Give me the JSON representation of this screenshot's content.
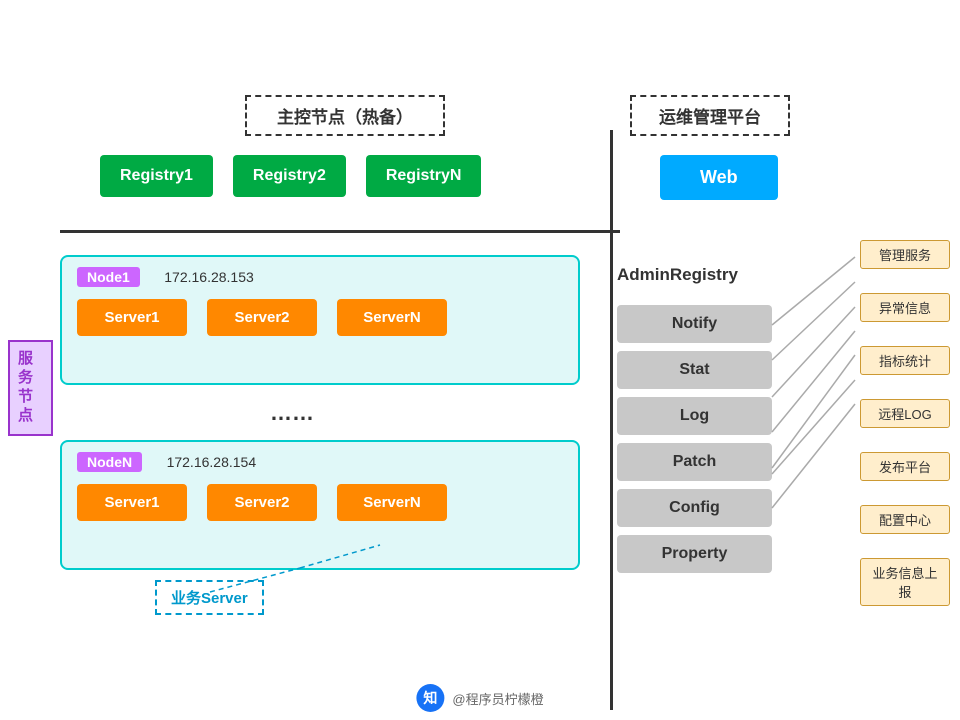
{
  "header": {
    "main_control_label": "主控节点（热备）",
    "ops_mgmt_label": "运维管理平台"
  },
  "registries": [
    {
      "label": "Registry1"
    },
    {
      "label": "Registry2"
    },
    {
      "label": "RegistryN"
    }
  ],
  "web_label": "Web",
  "service_node_label": "服务节点",
  "node1": {
    "label": "Node1",
    "ip": "172.16.28.153",
    "servers": [
      "Server1",
      "Server2",
      "ServerN"
    ]
  },
  "nodeN": {
    "label": "NodeN",
    "ip": "172.16.28.154",
    "servers": [
      "Server1",
      "Server2",
      "ServerN"
    ]
  },
  "dots": "……",
  "business_server_label": "业务Server",
  "admin_registry_label": "AdminRegistry",
  "service_boxes": [
    {
      "label": "Notify"
    },
    {
      "label": "Stat"
    },
    {
      "label": "Log"
    },
    {
      "label": "Patch"
    },
    {
      "label": "Config"
    },
    {
      "label": "Property"
    }
  ],
  "mgmt_labels": [
    {
      "label": "管理服务"
    },
    {
      "label": "异常信息"
    },
    {
      "label": "指标统计"
    },
    {
      "label": "远程LOG"
    },
    {
      "label": "发布平台"
    },
    {
      "label": "配置中心"
    },
    {
      "label": "业务信息上报"
    }
  ],
  "watermark": {
    "symbol": "知",
    "text": "@程序员柠檬橙"
  }
}
